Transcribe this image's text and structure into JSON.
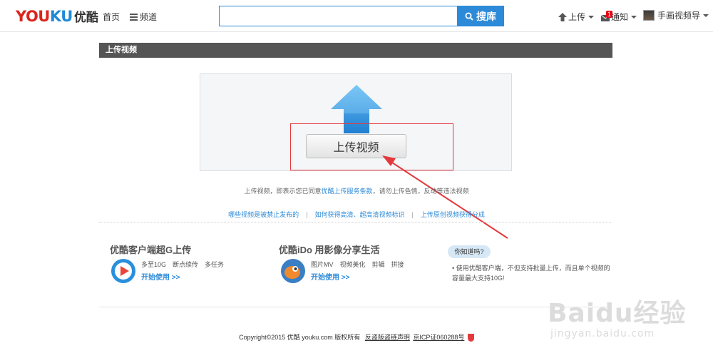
{
  "header": {
    "logo_text": "YOUKU",
    "logo_cn": "优酷",
    "nav_home": "首页",
    "nav_channel": "频道",
    "search_value": "",
    "search_button": "搜库",
    "upload_label": "上传",
    "notify_label": "通知",
    "notify_count": "1",
    "user_name": "手画视频导"
  },
  "section": {
    "title": "上传视频"
  },
  "upload": {
    "button_label": "上传视频",
    "agreement_prefix": "上传视频，即表示您已同意",
    "agreement_link": "优酷上传服务条款",
    "agreement_suffix": "，请勿上传色情，反动等违法视频"
  },
  "help_links": [
    "哪些视频是被禁止发布的",
    "如何获得高清、超高清视频标识",
    "上传原创视频获得分成"
  ],
  "promo_client": {
    "title": "优酷客户端超G上传",
    "tags": [
      "多至10G",
      "断点续传",
      "多任务"
    ],
    "start": "开始使用 >>"
  },
  "promo_ido": {
    "title": "优酷iDo 用影像分享生活",
    "tags": [
      "图片MV",
      "视频美化",
      "剪辑",
      "拼接"
    ],
    "start": "开始使用 >>"
  },
  "tip": {
    "bubble": "你知道吗?",
    "text": "• 使用优酷客户端，不但支持批量上传，而且单个视频的容量最大支持10G!"
  },
  "footer": {
    "copyright": "Copyright©2015 优酷 youku.com 版权所有",
    "piracy_link": "反盗版盗链声明",
    "icp_link": "京ICP证060288号"
  },
  "watermark": {
    "main": "Baidu经验",
    "sub": "jingyan.baidu.com"
  },
  "colors": {
    "brand_blue": "#2c8ad8",
    "brand_red": "#d9261c",
    "highlight_red": "#e4393c"
  }
}
